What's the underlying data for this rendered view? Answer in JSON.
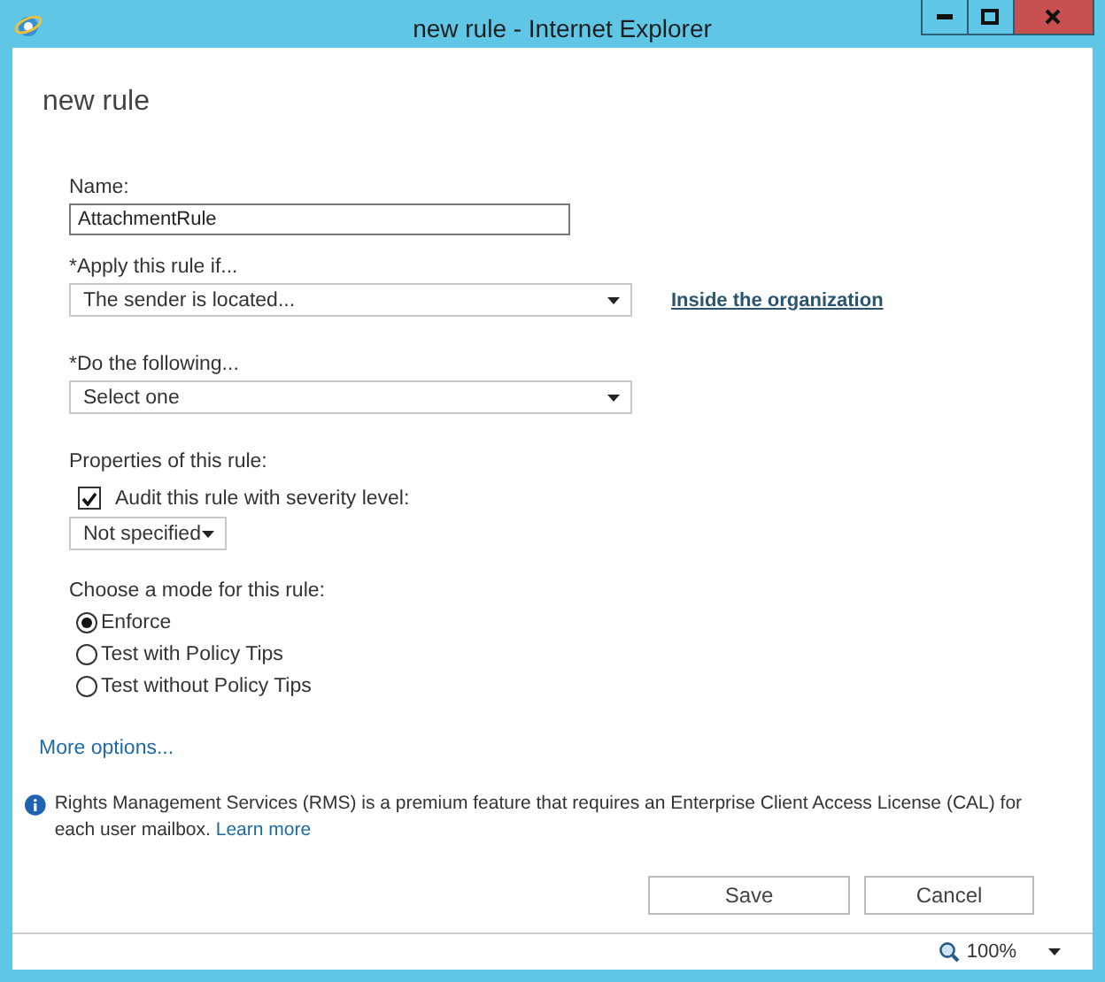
{
  "window": {
    "title": "new rule - Internet Explorer"
  },
  "page": {
    "heading": "new rule"
  },
  "form": {
    "name": {
      "label": "Name:",
      "value": "AttachmentRule"
    },
    "condition": {
      "label": "*Apply this rule if...",
      "value": "The sender is located...",
      "link": "Inside the organization"
    },
    "action": {
      "label": "*Do the following...",
      "value": "Select one"
    },
    "properties": {
      "label": "Properties of this rule:",
      "audit": {
        "label": "Audit this rule with severity level:",
        "checked": true
      },
      "severity": "Not specified"
    },
    "mode": {
      "label": "Choose a mode for this rule:",
      "options": [
        {
          "label": "Enforce",
          "selected": true
        },
        {
          "label": "Test with Policy Tips",
          "selected": false
        },
        {
          "label": "Test without Policy Tips",
          "selected": false
        }
      ]
    },
    "more_options": "More options..."
  },
  "notice": {
    "text": "Rights Management Services (RMS) is a premium feature that requires an Enterprise Client Access License (CAL) for each user mailbox.",
    "link": "Learn more"
  },
  "buttons": [
    "Save",
    "Cancel"
  ],
  "status_bar": {
    "zoom": "100%"
  }
}
